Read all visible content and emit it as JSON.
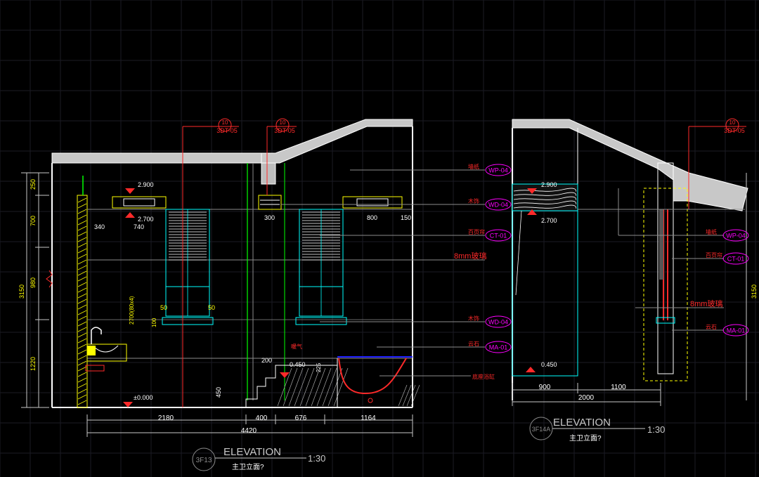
{
  "colors": {
    "background": "#000000",
    "grid": "#1a1a22",
    "wall": "#ffffff",
    "dim": "#c8c8c8",
    "dim_text": "#ffff00",
    "red": "#ff2a2a",
    "magenta": "#ff00ff",
    "cyan": "#00ffff",
    "green": "#00ff00",
    "yellow": "#ffff00",
    "grey": "#8c8c8c"
  },
  "left_elevation": {
    "title": "ELEVATION",
    "code": "3F13",
    "scale": "1:30",
    "subtitle": "主卫立面?",
    "section_tags": [
      {
        "num": "10",
        "ref": "3DT-05"
      },
      {
        "num": "10",
        "ref": "3DT-05"
      }
    ],
    "levels": [
      "2.900",
      "2.700",
      "0.450",
      "±0.000"
    ],
    "vertical_dims": [
      "250",
      "700",
      "980",
      "1220",
      "3150"
    ],
    "bottom_dims": [
      "2180",
      "400",
      "676",
      "1164"
    ],
    "total_dim": "4420",
    "top_dims": [
      "340",
      "740",
      "300",
      "800",
      "150"
    ],
    "inner_dims": [
      "50",
      "50",
      "100",
      "200",
      "225",
      "450"
    ],
    "window_label": "2700(80x4)",
    "callout_text": [
      "暖气",
      "底座浴缸"
    ]
  },
  "right_elevation": {
    "title": "ELEVATION",
    "code": "3F14A",
    "scale": "1:30",
    "subtitle": "主卫立面?",
    "section_tag": {
      "num": "10",
      "ref": "3DT-05"
    },
    "levels": [
      "2.900",
      "2.700",
      "0.450"
    ],
    "bottom_dims": [
      "900",
      "1100"
    ],
    "total_dim": "2000",
    "right_dim": "3150"
  },
  "material_tags": [
    {
      "label": "墙纸",
      "code": "WP-04"
    },
    {
      "label": "木饰",
      "code": "WD-04"
    },
    {
      "label": "百页帘",
      "code": "CT-01"
    },
    {
      "label": "8mm玻璃",
      "code": ""
    },
    {
      "label": "木饰",
      "code": "WD-04"
    },
    {
      "label": "云石",
      "code": "MA-01"
    }
  ],
  "right_material_tags": [
    {
      "label": "墙纸",
      "code": "WP-04"
    },
    {
      "label": "百页帘",
      "code": "CT-01"
    },
    {
      "label": "8mm玻璃",
      "code": ""
    },
    {
      "label": "云石",
      "code": "MA-01"
    }
  ]
}
